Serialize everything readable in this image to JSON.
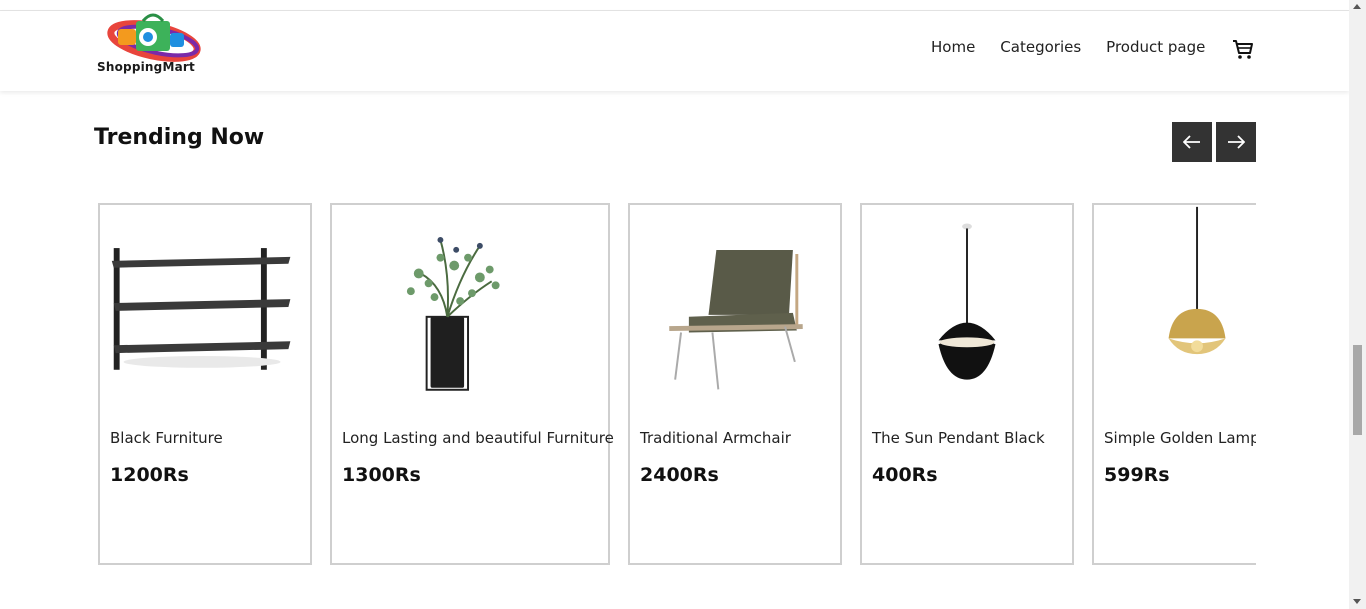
{
  "brand": {
    "name": "ShoppingMart"
  },
  "nav": {
    "items": [
      {
        "label": "Home"
      },
      {
        "label": "Categories"
      },
      {
        "label": "Product page"
      }
    ],
    "cart_icon": "cart-icon"
  },
  "trending": {
    "title": "Trending Now",
    "prev_icon": "arrow-left-icon",
    "next_icon": "arrow-right-icon",
    "products": [
      {
        "name": "Black Furniture",
        "price": "1200Rs",
        "image": "wall-shelf"
      },
      {
        "name": "Long Lasting and beautiful Furniture",
        "price": "1300Rs",
        "image": "plant-vase"
      },
      {
        "name": "Traditional Armchair",
        "price": "2400Rs",
        "image": "armchair"
      },
      {
        "name": "The Sun Pendant Black",
        "price": "400Rs",
        "image": "pendant-lamp-black"
      },
      {
        "name": "Simple Golden Lamp",
        "price": "599Rs",
        "image": "pendant-lamp-gold"
      }
    ]
  },
  "colors": {
    "arrow_bg": "#333333",
    "card_border": "#cfcfcf"
  }
}
